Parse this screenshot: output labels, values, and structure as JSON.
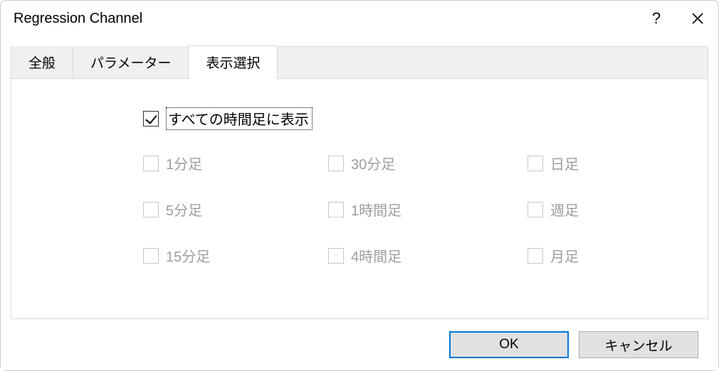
{
  "window": {
    "title": "Regression Channel"
  },
  "tabs": {
    "general": "全般",
    "params": "パラメーター",
    "display": "表示選択"
  },
  "display": {
    "show_all_tf": "すべての時間足に表示",
    "show_all_tf_checked": true,
    "tf": {
      "m1": "1分足",
      "m5": "5分足",
      "m15": "15分足",
      "m30": "30分足",
      "h1": "1時間足",
      "h4": "4時間足",
      "d1": "日足",
      "w1": "週足",
      "mn1": "月足"
    }
  },
  "buttons": {
    "ok": "OK",
    "cancel": "キャンセル"
  }
}
